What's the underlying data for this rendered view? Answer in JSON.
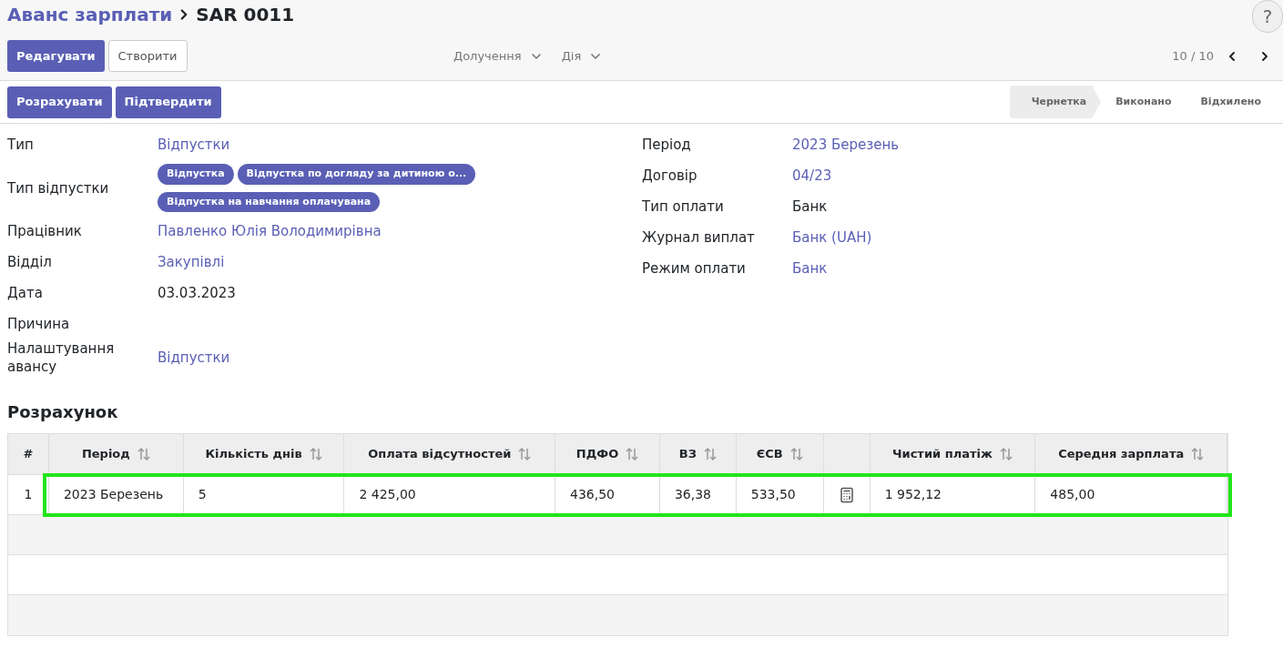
{
  "breadcrumb": {
    "parent": "Аванс зарплати",
    "current": "SAR 0011"
  },
  "help_button": "?",
  "toolbar": {
    "buttons": [
      {
        "label": "Редагувати",
        "primary": true
      },
      {
        "label": "Створити",
        "primary": false
      }
    ],
    "menus": [
      "Долучення",
      "Дія"
    ],
    "pager": "10 / 10"
  },
  "actions": [
    "Розрахувати",
    "Підтвердити"
  ],
  "status_steps": [
    {
      "label": "Чернетка",
      "selected": true
    },
    {
      "label": "Виконано",
      "selected": false
    },
    {
      "label": "Відхилено",
      "selected": false
    }
  ],
  "left_fields": [
    {
      "label": "Тип",
      "kind": "link",
      "value": "Відпустки"
    },
    {
      "label": "Тип відпустки",
      "kind": "tags",
      "tags": [
        "Відпустка",
        "Відпустка по догляду за дитиною о...",
        "Відпустка на навчання оплачувана"
      ]
    },
    {
      "label": "Працівник",
      "kind": "link",
      "value": "Павленко Юлія Володимирівна"
    },
    {
      "label": "Відділ",
      "kind": "link",
      "value": "Закупівлі"
    },
    {
      "label": "Дата",
      "kind": "text",
      "value": "03.03.2023"
    },
    {
      "label": "Причина",
      "kind": "empty"
    },
    {
      "label": "Налаштування авансу",
      "kind": "link",
      "value": "Відпустки"
    }
  ],
  "right_fields": [
    {
      "label": "Період",
      "kind": "link",
      "value": "2023 Березень"
    },
    {
      "label": "Договір",
      "kind": "link",
      "value": "04/23"
    },
    {
      "label": "Тип оплати",
      "kind": "text",
      "value": "Банк"
    },
    {
      "label": "Журнал виплат",
      "kind": "link",
      "value": "Банк (UAH)"
    },
    {
      "label": "Режим оплати",
      "kind": "link",
      "value": "Банк"
    }
  ],
  "section_title": "Розрахунок",
  "table": {
    "columns": [
      {
        "label": "#",
        "sortable": false
      },
      {
        "label": "Період",
        "sortable": true
      },
      {
        "label": "Кількість днів",
        "sortable": true
      },
      {
        "label": "Оплата відсутностей",
        "sortable": true
      },
      {
        "label": "ПДФО",
        "sortable": true
      },
      {
        "label": "ВЗ",
        "sortable": true
      },
      {
        "label": "ЄСВ",
        "sortable": true
      },
      {
        "sortable": false
      },
      {
        "label": "Чистий платіж",
        "sortable": true
      },
      {
        "label": "Середня зарплата",
        "sortable": true
      }
    ],
    "rows": [
      {
        "highlighted": true,
        "cells": [
          {
            "kind": "text",
            "value": "1"
          },
          {
            "kind": "text",
            "value": "2023 Березень"
          },
          {
            "kind": "text",
            "value": "5"
          },
          {
            "kind": "text",
            "value": "2 425,00"
          },
          {
            "kind": "text",
            "value": "436,50"
          },
          {
            "kind": "text",
            "value": "36,38"
          },
          {
            "kind": "text",
            "value": "533,50"
          },
          {
            "kind": "icon"
          },
          {
            "kind": "text",
            "value": "1 952,12"
          },
          {
            "kind": "text",
            "value": "485,00"
          }
        ]
      }
    ]
  }
}
